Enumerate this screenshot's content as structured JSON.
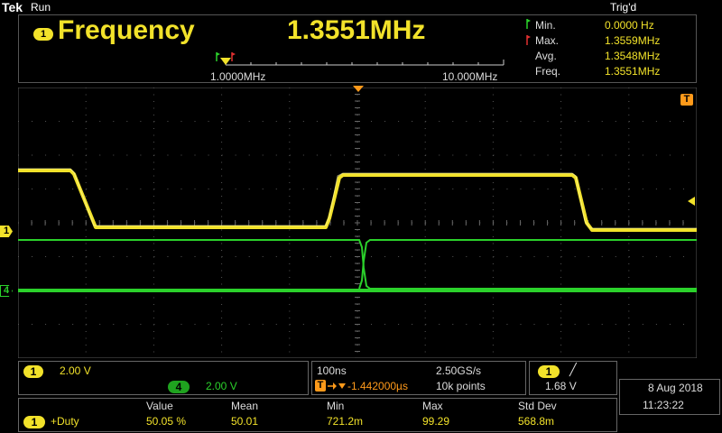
{
  "header": {
    "brand": "Tek",
    "run_state": "Run",
    "trigger_state": "Trig'd"
  },
  "measurement": {
    "channel": "1",
    "name": "Frequency",
    "value": "1.3551MHz",
    "scale_min": "1.0000MHz",
    "scale_max": "10.000MHz",
    "stats": [
      {
        "label": "Min.",
        "value": "0.0000 Hz"
      },
      {
        "label": "Max.",
        "value": "1.3559MHz"
      },
      {
        "label": "Avg.",
        "value": "1.3548MHz"
      },
      {
        "label": "Freq.",
        "value": "1.3551MHz"
      }
    ]
  },
  "markers": {
    "ch1": "1",
    "ch4": "4",
    "trigger": "T"
  },
  "vertical": {
    "ch1_badge": "1",
    "ch1_scale": "2.00 V",
    "ch4_badge": "4",
    "ch4_scale": "2.00 V"
  },
  "horizontal": {
    "timebase": "100ns",
    "sample_rate": "2.50GS/s",
    "trigger_offset": "-1.442000µs",
    "record_length": "10k points"
  },
  "trigger": {
    "channel": "1",
    "slope": "╱",
    "level": "1.68 V"
  },
  "datetime": {
    "date": "8 Aug 2018",
    "time": "11:23:22"
  },
  "stats_table": {
    "headers": [
      "Value",
      "Mean",
      "Min",
      "Max",
      "Std Dev"
    ],
    "row": {
      "channel": "1",
      "name": "+Duty",
      "values": [
        "50.05 %",
        "50.01",
        "721.2m",
        "99.29",
        "568.8m"
      ]
    }
  },
  "colors": {
    "ch1": "#f2e22a",
    "ch4": "#2bd12b",
    "trigger": "#ff9a1a",
    "grid": "#5a5a5a"
  }
}
